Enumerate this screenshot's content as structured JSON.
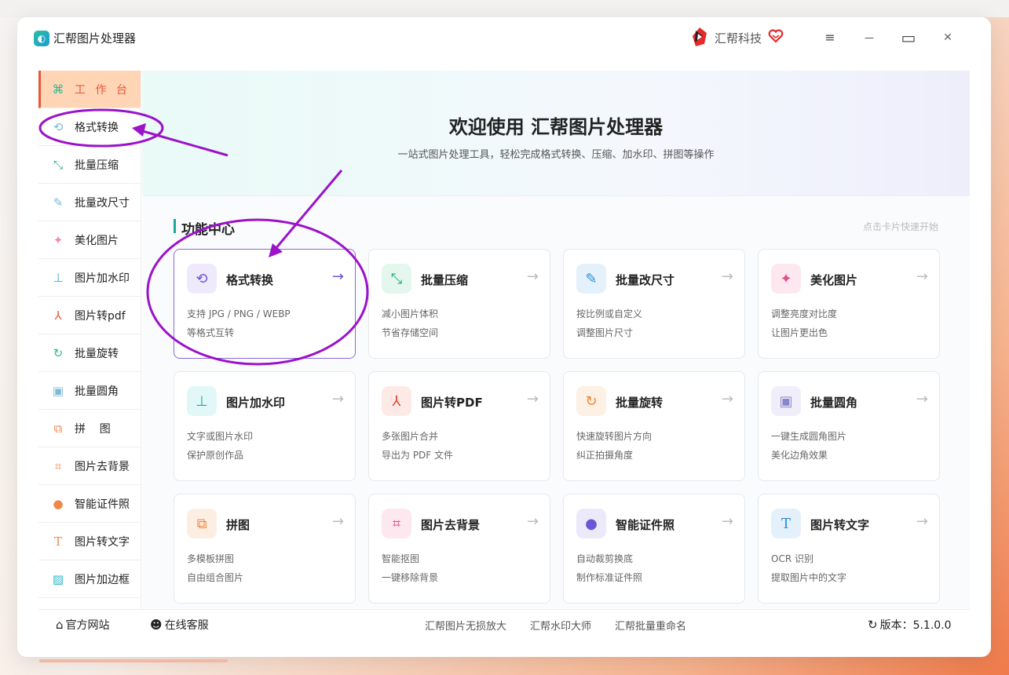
{
  "app": {
    "title": "汇帮图片处理器",
    "brand": "汇帮科技"
  },
  "window_controls": {
    "menu": "≡",
    "minimize": "—",
    "maximize": "▭",
    "close": "✕"
  },
  "sidebar": {
    "items": [
      {
        "label": "工 作 台",
        "icon": "dashboard-icon",
        "color": "#2bb98f"
      },
      {
        "label": "格式转换",
        "icon": "convert-icon",
        "color": "#7bbad9"
      },
      {
        "label": "批量压缩",
        "icon": "compress-icon",
        "color": "#2bb98f"
      },
      {
        "label": "批量改尺寸",
        "icon": "resize-icon",
        "color": "#7bbad9"
      },
      {
        "label": "美化图片",
        "icon": "beautify-icon",
        "color": "#f08aa8"
      },
      {
        "label": "图片加水印",
        "icon": "watermark-icon",
        "color": "#2bb8c8"
      },
      {
        "label": "图片转pdf",
        "icon": "pdf-icon",
        "color": "#e85c3a"
      },
      {
        "label": "批量旋转",
        "icon": "rotate-icon",
        "color": "#2bb98f"
      },
      {
        "label": "批量圆角",
        "icon": "rounded-corner-icon",
        "color": "#7bbad9"
      },
      {
        "label": "拼    图",
        "icon": "collage-icon",
        "color": "#f0874a"
      },
      {
        "label": "图片去背景",
        "icon": "crop-icon",
        "color": "#f0874a"
      },
      {
        "label": "智能证件照",
        "icon": "id-photo-icon",
        "color": "#f0874a"
      },
      {
        "label": "图片转文字",
        "icon": "text-icon",
        "color": "#f0874a"
      },
      {
        "label": "图片加边框",
        "icon": "frame-icon",
        "color": "#2bb8c8"
      }
    ]
  },
  "hero": {
    "title": "欢迎使用 汇帮图片处理器",
    "subtitle": "一站式图片处理工具，轻松完成格式转换、压缩、加水印、拼图等操作"
  },
  "features": {
    "title": "功能中心",
    "hint": "点击卡片快速开始",
    "arrow": "→",
    "cards": [
      {
        "title": "格式转换",
        "d1": "支持 JPG / PNG / WEBP",
        "d2": "等格式互转",
        "icon": "convert-icon",
        "glyph": "⟲",
        "bg": "#eeeafb",
        "fg": "#6a56d6"
      },
      {
        "title": "批量压缩",
        "d1": "减小图片体积",
        "d2": "节省存储空间",
        "icon": "compress-icon",
        "glyph": "⤡",
        "bg": "#e3f7ef",
        "fg": "#20a87a"
      },
      {
        "title": "批量改尺寸",
        "d1": "按比例或自定义",
        "d2": "调整图片尺寸",
        "icon": "resize-icon",
        "glyph": "✎",
        "bg": "#e4f1fb",
        "fg": "#2b8fd6"
      },
      {
        "title": "美化图片",
        "d1": "调整亮度对比度",
        "d2": "让图片更出色",
        "icon": "beautify-icon",
        "glyph": "✦",
        "bg": "#fde8f0",
        "fg": "#e0508a"
      },
      {
        "title": "图片加水印",
        "d1": "文字或图片水印",
        "d2": "保护原创作品",
        "icon": "watermark-icon",
        "glyph": "⊥",
        "bg": "#e2f7f7",
        "fg": "#1fa9b5"
      },
      {
        "title": "图片转PDF",
        "d1": "多张图片合并",
        "d2": "导出为 PDF 文件",
        "icon": "pdf-icon",
        "glyph": "⅄",
        "bg": "#fdeae6",
        "fg": "#e04a2f"
      },
      {
        "title": "批量旋转",
        "d1": "快速旋转图片方向",
        "d2": "纠正拍摄角度",
        "icon": "rotate-icon",
        "glyph": "↻",
        "bg": "#fdf0e4",
        "fg": "#f0873a"
      },
      {
        "title": "批量圆角",
        "d1": "一键生成圆角图片",
        "d2": "美化边角效果",
        "icon": "rounded-corner-icon",
        "glyph": "▣",
        "bg": "#efeefa",
        "fg": "#8a86c8"
      },
      {
        "title": "拼图",
        "d1": "多模板拼图",
        "d2": "自由组合图片",
        "icon": "collage-icon",
        "glyph": "⧉",
        "bg": "#fdeee4",
        "fg": "#f0873a"
      },
      {
        "title": "图片去背景",
        "d1": "智能抠图",
        "d2": "一键移除背景",
        "icon": "crop-icon",
        "glyph": "⌗",
        "bg": "#fde8ef",
        "fg": "#e0508a"
      },
      {
        "title": "智能证件照",
        "d1": "自动裁剪换底",
        "d2": "制作标准证件照",
        "icon": "id-photo-icon",
        "glyph": "●",
        "bg": "#ece9fb",
        "fg": "#6a56d6"
      },
      {
        "title": "图片转文字",
        "d1": "OCR 识别",
        "d2": "提取图片中的文字",
        "icon": "text-icon",
        "glyph": "T",
        "bg": "#e4f1fb",
        "fg": "#2b8fd6"
      }
    ]
  },
  "footer": {
    "website": "官方网站",
    "service": "在线客服",
    "links": [
      "汇帮图片无损放大",
      "汇帮水印大师",
      "汇帮批量重命名"
    ],
    "version": "版本：5.1.0.0"
  }
}
